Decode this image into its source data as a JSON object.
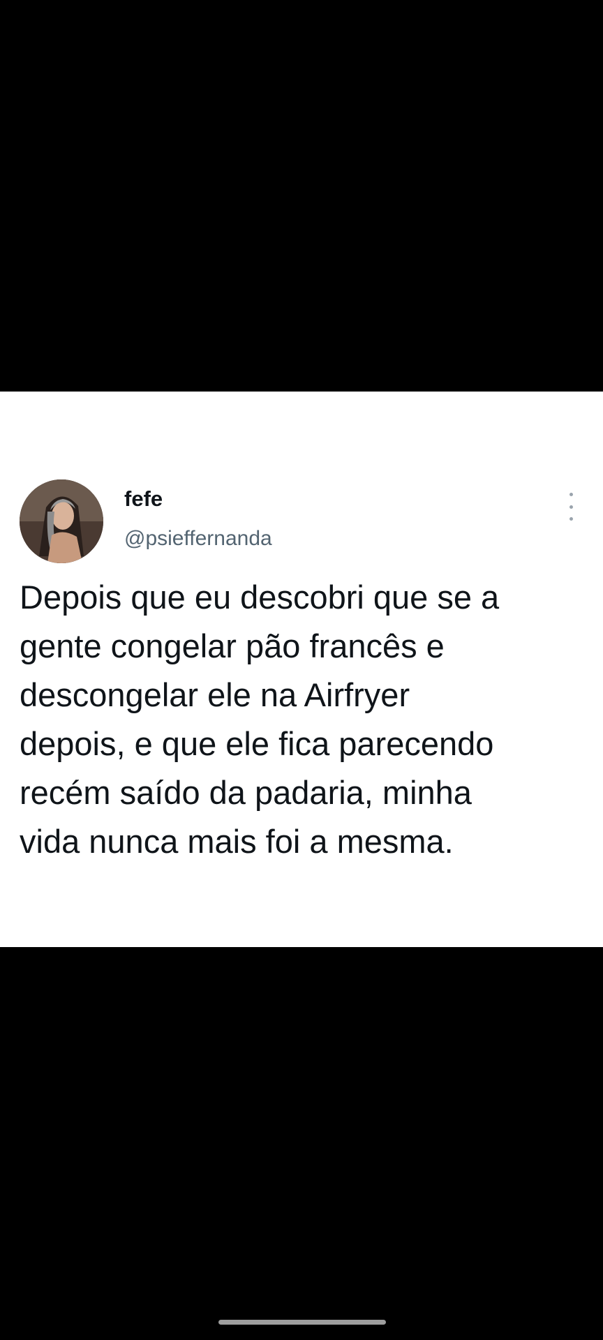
{
  "tweet": {
    "display_name": "fefe",
    "handle": "@psieffernanda",
    "text": "Depois que eu descobri que se a\ngente congelar pão francês e\ndescongelar ele na Airfryer\ndepois, e que ele fica parecendo\nrecém saído da padaria, minha\nvida nunca mais foi a mesma.",
    "avatar_icon": "profile-photo",
    "more_icon": "vertical-ellipsis-icon"
  },
  "colors": {
    "background_outer": "#000000",
    "card_background": "#ffffff",
    "name_color": "#0f1419",
    "handle_color": "#536471",
    "text_color": "#0f1419",
    "home_indicator": "#9e9e9e"
  }
}
